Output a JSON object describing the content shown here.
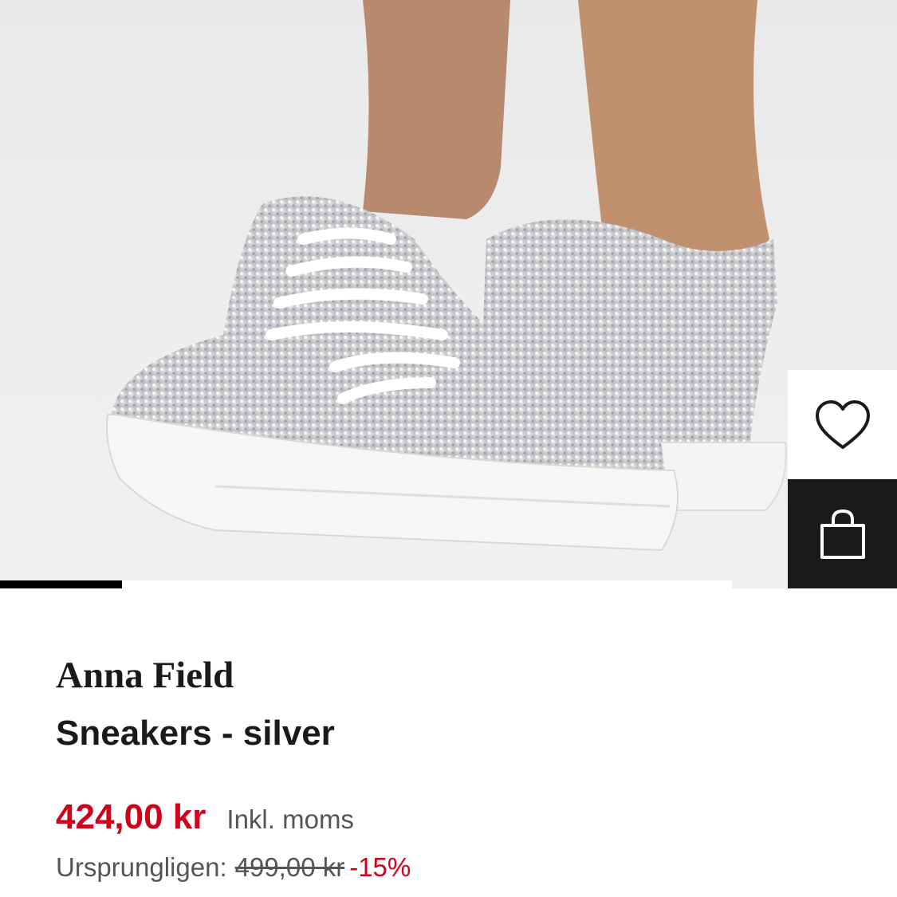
{
  "product": {
    "brand": "Anna Field",
    "name": "Sneakers - silver",
    "price": "424,00 kr",
    "vat_note": "Inkl. moms",
    "original_label": "Ursprungligen:",
    "original_price": "499,00 kr",
    "discount": "-15%",
    "image_index": 1,
    "image_count": 6
  },
  "actions": {
    "wishlist_icon": "heart-outline-icon",
    "cart_icon": "shopping-bag-icon"
  },
  "colors": {
    "price_red": "#d0021b",
    "text_dark": "#1a1a1a",
    "text_muted": "#555555",
    "cart_bg": "#1a1a1a"
  }
}
